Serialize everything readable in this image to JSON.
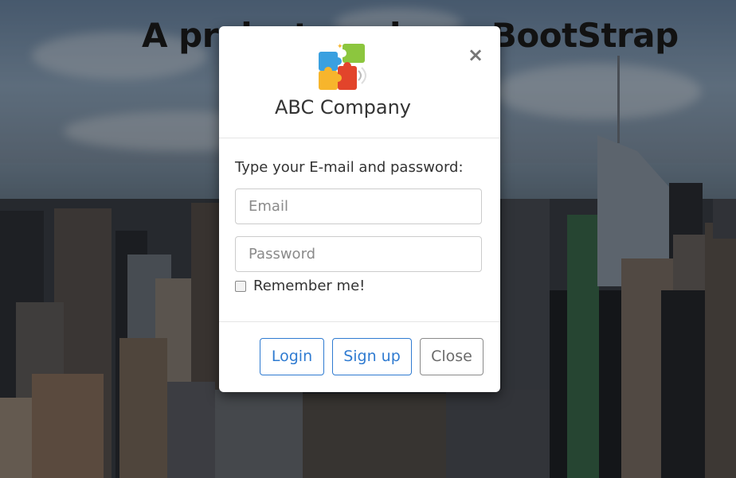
{
  "background": {
    "hero_title": "A project made on BootStrap"
  },
  "modal": {
    "company_name": "ABC Company",
    "logo_icon": "puzzle-pieces-icon",
    "close_glyph": "×",
    "prompt": "Type your E-mail and password:",
    "email": {
      "value": "",
      "placeholder": "Email"
    },
    "password": {
      "value": "",
      "placeholder": "Password"
    },
    "remember_label": "Remember me!",
    "remember_checked": false,
    "buttons": {
      "login": "Login",
      "signup": "Sign up",
      "close": "Close"
    }
  },
  "colors": {
    "primary_outline": "#2f7bd1",
    "default_outline": "#8a8a8a",
    "backdrop": "rgba(0,0,0,0.35)"
  }
}
